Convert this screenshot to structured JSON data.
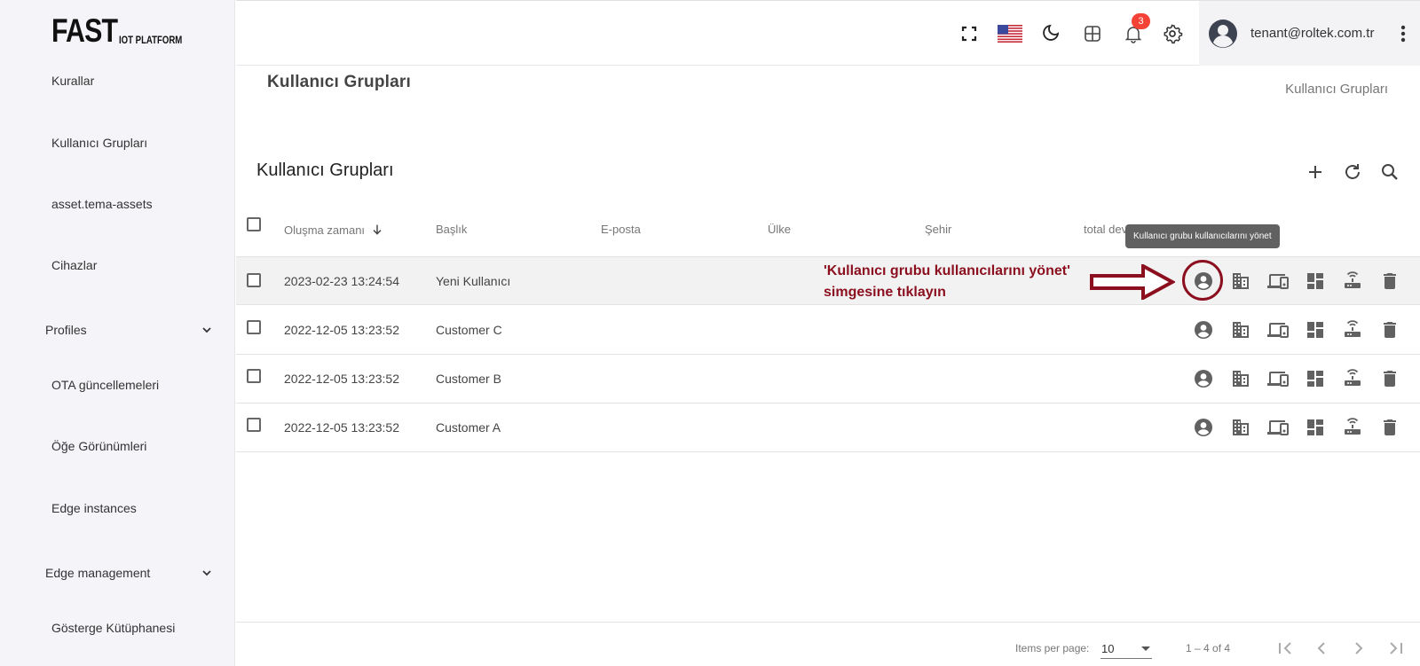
{
  "logo": {
    "main": "FAST",
    "sub": "IOT PLATFORM"
  },
  "sidebar": {
    "items": [
      {
        "label": "Kurallar"
      },
      {
        "label": "Kullanıcı Grupları"
      },
      {
        "label": "asset.tema-assets"
      },
      {
        "label": "Cihazlar"
      },
      {
        "label": "Profiles",
        "expandable": true
      },
      {
        "label": "OTA güncellemeleri"
      },
      {
        "label": "Öğe Görünümleri"
      },
      {
        "label": "Edge instances"
      },
      {
        "label": "Edge management",
        "expandable": true
      },
      {
        "label": "Gösterge Kütüphanesi"
      }
    ]
  },
  "topbar": {
    "notification_count": "3",
    "user_email": "tenant@roltek.com.tr",
    "icons": [
      "fullscreen-icon",
      "us-flag-icon",
      "dark-mode-icon",
      "apps-icon",
      "notifications-icon",
      "settings-icon"
    ]
  },
  "page": {
    "title": "Kullanıcı Grupları",
    "breadcrumb": "Kullanıcı Grupları"
  },
  "table": {
    "title": "Kullanıcı Grupları",
    "columns": [
      "Oluşma zamanı",
      "Başlık",
      "E-posta",
      "Ülke",
      "Şehir",
      "total dev"
    ],
    "sort_column": "Oluşma zamanı",
    "sort_direction": "descending",
    "rows": [
      {
        "created": "2023-02-23 13:24:54",
        "title": "Yeni Kullanıcı",
        "email": "",
        "country": "",
        "city": ""
      },
      {
        "created": "2022-12-05 13:23:52",
        "title": "Customer C",
        "email": "",
        "country": "",
        "city": ""
      },
      {
        "created": "2022-12-05 13:23:52",
        "title": "Customer B",
        "email": "",
        "country": "",
        "city": ""
      },
      {
        "created": "2022-12-05 13:23:52",
        "title": "Customer A",
        "email": "",
        "country": "",
        "city": ""
      }
    ],
    "row_actions": [
      "manage-users-icon",
      "manage-assets-icon",
      "manage-devices-icon",
      "manage-dashboards-icon",
      "manage-edges-icon",
      "delete-icon"
    ]
  },
  "tooltip": "Kullanıcı grubu kullanıcılarını yönet",
  "annotation": {
    "line1": "'Kullanıcı grubu kullanıcılarını yönet'",
    "line2": "simgesine tıklayın",
    "color": "#8b0f1e"
  },
  "pagination": {
    "items_per_page_label": "Items per page:",
    "items_per_page": "10",
    "range": "1 – 4 of 4"
  }
}
